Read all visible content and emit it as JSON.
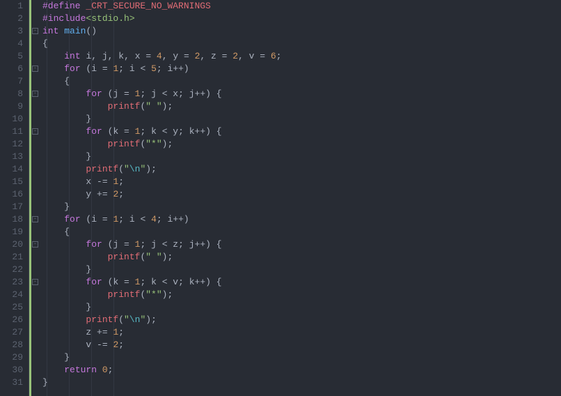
{
  "lines": {
    "count": 31,
    "numbers": [
      "1",
      "2",
      "3",
      "4",
      "5",
      "6",
      "7",
      "8",
      "9",
      "10",
      "11",
      "12",
      "13",
      "14",
      "15",
      "16",
      "17",
      "18",
      "19",
      "20",
      "21",
      "22",
      "23",
      "24",
      "25",
      "26",
      "27",
      "28",
      "29",
      "30",
      "31"
    ]
  },
  "fold": {
    "collapsed_glyph": "-",
    "positions": [
      3,
      6,
      8,
      11,
      18,
      20,
      23
    ]
  },
  "code": {
    "l1": {
      "define": "#define",
      "macro": "_CRT_SECURE_NO_WARNINGS"
    },
    "l2": {
      "include": "#include",
      "hdr": "<stdio.h>"
    },
    "l3": {
      "type": "int",
      "main": "main",
      "paren": "()"
    },
    "l4": {
      "brace": "{"
    },
    "l5": {
      "type": "int",
      "v1": "i",
      "v2": "j",
      "v3": "k",
      "v4": "x",
      "n4": "4",
      "v5": "y",
      "n5": "2",
      "v6": "z",
      "n6": "2",
      "v7": "v",
      "n7": "6"
    },
    "l6": {
      "for": "for",
      "v": "i",
      "n1": "1",
      "n2": "5",
      "inc": "i++"
    },
    "l7": {
      "brace": "{"
    },
    "l8": {
      "for": "for",
      "v": "j",
      "n1": "1",
      "vv": "x",
      "inc": "j++"
    },
    "l9": {
      "fn": "printf",
      "s": "\" \""
    },
    "l10": {
      "brace": "}"
    },
    "l11": {
      "for": "for",
      "v": "k",
      "n1": "1",
      "vv": "y",
      "inc": "k++"
    },
    "l12": {
      "fn": "printf",
      "s": "\"*\""
    },
    "l13": {
      "brace": "}"
    },
    "l14": {
      "fn": "printf",
      "s1": "\"",
      "esc": "\\n",
      "s2": "\""
    },
    "l15": {
      "v": "x",
      "op": "-=",
      "n": "1"
    },
    "l16": {
      "v": "y",
      "op": "+=",
      "n": "2"
    },
    "l17": {
      "brace": "}"
    },
    "l18": {
      "for": "for",
      "v": "i",
      "n1": "1",
      "n2": "4",
      "inc": "i++"
    },
    "l19": {
      "brace": "{"
    },
    "l20": {
      "for": "for",
      "v": "j",
      "n1": "1",
      "vv": "z",
      "inc": "j++"
    },
    "l21": {
      "fn": "printf",
      "s": "\" \""
    },
    "l22": {
      "brace": "}"
    },
    "l23": {
      "for": "for",
      "v": "k",
      "n1": "1",
      "vv": "v",
      "inc": "k++"
    },
    "l24": {
      "fn": "printf",
      "s": "\"*\""
    },
    "l25": {
      "brace": "}"
    },
    "l26": {
      "fn": "printf",
      "s1": "\"",
      "esc": "\\n",
      "s2": "\""
    },
    "l27": {
      "v": "z",
      "op": "+=",
      "n": "1"
    },
    "l28": {
      "v": "v",
      "op": "-=",
      "n": "2"
    },
    "l29": {
      "brace": "}"
    },
    "l30": {
      "ret": "return",
      "n": "0"
    },
    "l31": {
      "brace": "}"
    }
  }
}
